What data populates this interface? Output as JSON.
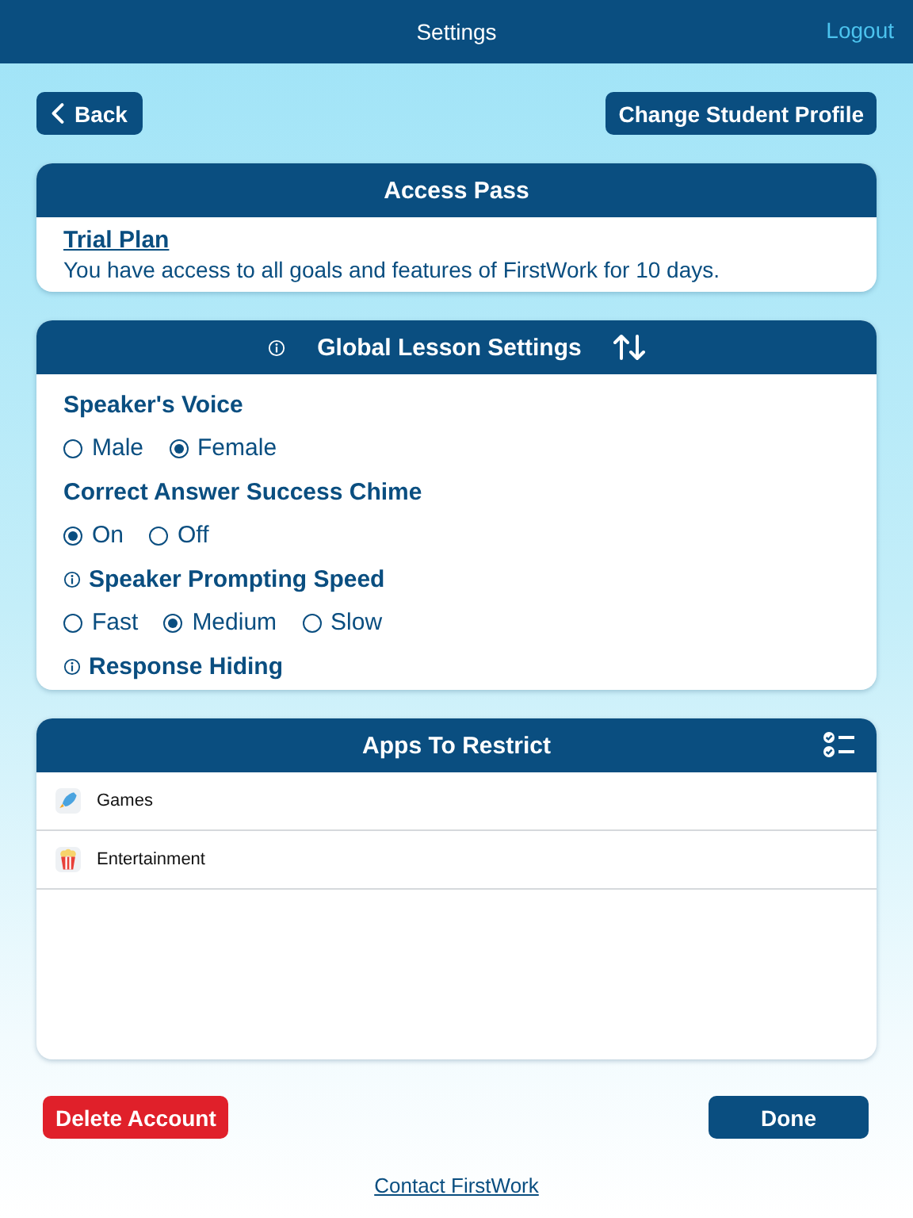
{
  "header": {
    "title": "Settings",
    "logout": "Logout"
  },
  "top_buttons": {
    "back": "Back",
    "change_profile": "Change Student Profile"
  },
  "access_pass": {
    "title": "Access Pass",
    "plan": "Trial Plan",
    "description": "You have access to all goals and features of FirstWork for 10 days."
  },
  "lesson_settings": {
    "title": "Global Lesson Settings",
    "groups": [
      {
        "label": "Speaker's Voice",
        "info": false,
        "options": [
          {
            "label": "Male",
            "selected": false
          },
          {
            "label": "Female",
            "selected": true
          }
        ]
      },
      {
        "label": "Correct Answer Success Chime",
        "info": false,
        "options": [
          {
            "label": "On",
            "selected": true
          },
          {
            "label": "Off",
            "selected": false
          }
        ]
      },
      {
        "label": "Speaker Prompting Speed",
        "info": true,
        "options": [
          {
            "label": "Fast",
            "selected": false
          },
          {
            "label": "Medium",
            "selected": true
          },
          {
            "label": "Slow",
            "selected": false
          }
        ]
      },
      {
        "label": "Response Hiding",
        "info": true
      }
    ]
  },
  "apps_to_restrict": {
    "title": "Apps To Restrict",
    "items": [
      {
        "label": "Games",
        "kind": "games"
      },
      {
        "label": "Entertainment",
        "kind": "entertainment"
      }
    ]
  },
  "bottom_buttons": {
    "delete": "Delete Account",
    "done": "Done"
  },
  "contact_link": "Contact FirstWork"
}
